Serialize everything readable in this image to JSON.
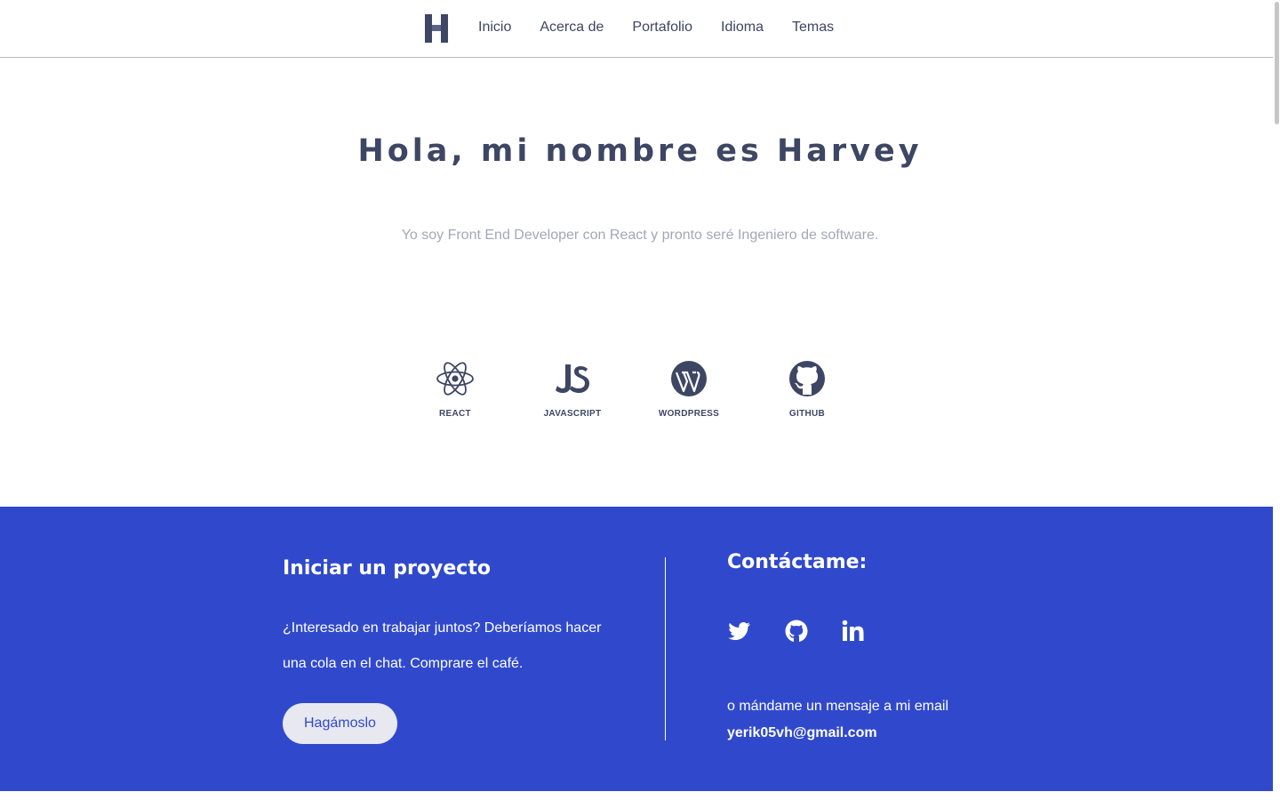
{
  "nav": {
    "brand_icon": "h-logo-icon",
    "links": [
      "Inicio",
      "Acerca de",
      "Portafolio",
      "Idioma",
      "Temas"
    ]
  },
  "hero": {
    "title": "Hola, mi nombre es Harvey",
    "subtitle": "Yo soy Front End Developer con React y pronto seré Ingeniero de software."
  },
  "skills": [
    {
      "label": "REACT",
      "icon": "react-icon"
    },
    {
      "label": "JAVASCRIPT",
      "icon": "javascript-icon"
    },
    {
      "label": "WORDPRESS",
      "icon": "wordpress-icon"
    },
    {
      "label": "GITHUB",
      "icon": "github-icon"
    }
  ],
  "footer": {
    "project_heading": "Iniciar un proyecto",
    "project_text": "¿Interesado en trabajar juntos? Deberíamos hacer una cola en el chat. Comprare el café.",
    "cta_label": "Hagámoslo",
    "contact_heading": "Contáctame:",
    "socials": [
      "twitter-icon",
      "github-icon",
      "linkedin-icon"
    ],
    "contact_text": "o mándame un mensaje a mi email",
    "email": "yerik05vh@gmail.com"
  },
  "colors": {
    "primary": "#3049cc",
    "text_dark": "#3d4663",
    "text_muted": "#a3a7b8",
    "button_bg": "#e8e8f0"
  }
}
